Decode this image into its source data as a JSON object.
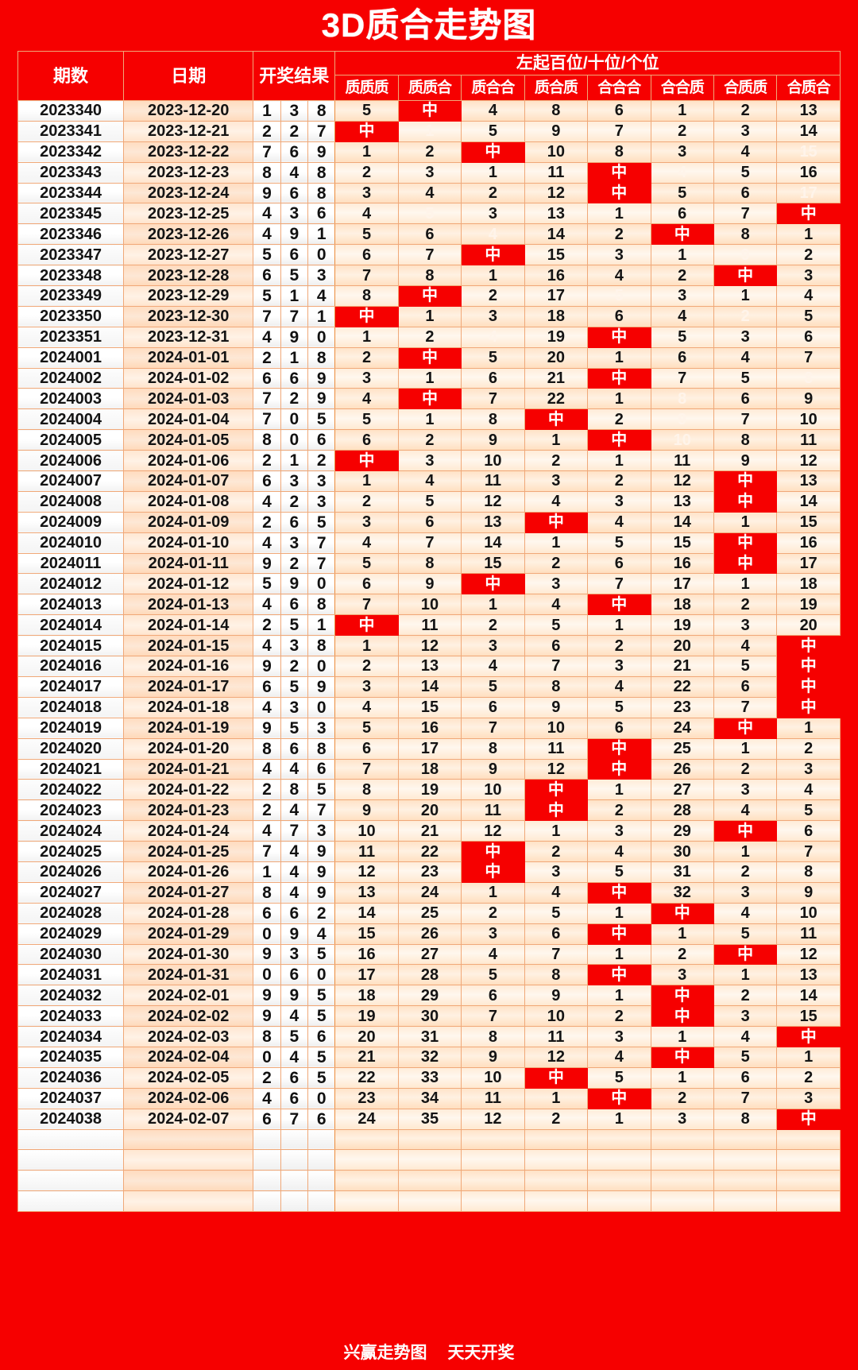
{
  "title": "3D质合走势图",
  "footer": {
    "left": "兴赢走势图",
    "right": "天天开奖"
  },
  "headers": {
    "issue": "期数",
    "date": "日期",
    "result": "开奖结果",
    "group": "左起百位/十位/个位",
    "positions": [
      "质质质",
      "质质合",
      "质合合",
      "质合质",
      "合合合",
      "合合质",
      "合质质",
      "合质合"
    ]
  },
  "hit_mark": "中",
  "colors": {
    "brand_red": "#f60000",
    "cell_peach": "#ffe3c8",
    "grid_line": "#f0a878",
    "faded_text": "#fff4ea",
    "text": "#141414"
  },
  "chart_data": {
    "type": "table",
    "title": "3D质合走势图",
    "columns": [
      "期数",
      "日期",
      "开奖结果",
      "质质质",
      "质质合",
      "质合合",
      "质合质",
      "合合合",
      "合合质",
      "合质质",
      "合质合"
    ],
    "empty_rows": 4,
    "rows": [
      {
        "issue": "2023340",
        "date": "2023-12-20",
        "balls": [
          1,
          3,
          8
        ],
        "cells": [
          "5",
          "中",
          "4",
          "8",
          "6",
          "1",
          "2",
          "13"
        ],
        "faded": []
      },
      {
        "issue": "2023341",
        "date": "2023-12-21",
        "balls": [
          2,
          2,
          7
        ],
        "cells": [
          "中",
          "1",
          "5",
          "9",
          "7",
          "2",
          "3",
          "14"
        ],
        "faded": [
          1
        ]
      },
      {
        "issue": "2023342",
        "date": "2023-12-22",
        "balls": [
          7,
          6,
          9
        ],
        "cells": [
          "1",
          "2",
          "中",
          "10",
          "8",
          "3",
          "4",
          "15"
        ],
        "faded": [
          7
        ]
      },
      {
        "issue": "2023343",
        "date": "2023-12-23",
        "balls": [
          8,
          4,
          8
        ],
        "cells": [
          "2",
          "3",
          "1",
          "11",
          "中",
          "4",
          "5",
          "16"
        ],
        "faded": [
          5
        ]
      },
      {
        "issue": "2023344",
        "date": "2023-12-24",
        "balls": [
          9,
          6,
          8
        ],
        "cells": [
          "3",
          "4",
          "2",
          "12",
          "中",
          "5",
          "6",
          "17"
        ],
        "faded": [
          7
        ]
      },
      {
        "issue": "2023345",
        "date": "2023-12-25",
        "balls": [
          4,
          3,
          6
        ],
        "cells": [
          "4",
          "5",
          "3",
          "13",
          "1",
          "6",
          "7",
          "中"
        ],
        "faded": [
          1
        ]
      },
      {
        "issue": "2023346",
        "date": "2023-12-26",
        "balls": [
          4,
          9,
          1
        ],
        "cells": [
          "5",
          "6",
          "4",
          "14",
          "2",
          "中",
          "8",
          "1"
        ],
        "faded": [
          2
        ]
      },
      {
        "issue": "2023347",
        "date": "2023-12-27",
        "balls": [
          5,
          6,
          0
        ],
        "cells": [
          "6",
          "7",
          "中",
          "15",
          "3",
          "1",
          "9",
          "2"
        ],
        "faded": [
          6
        ]
      },
      {
        "issue": "2023348",
        "date": "2023-12-28",
        "balls": [
          6,
          5,
          3
        ],
        "cells": [
          "7",
          "8",
          "1",
          "16",
          "4",
          "2",
          "中",
          "3"
        ],
        "faded": []
      },
      {
        "issue": "2023349",
        "date": "2023-12-29",
        "balls": [
          5,
          1,
          4
        ],
        "cells": [
          "8",
          "中",
          "2",
          "17",
          "5",
          "3",
          "1",
          "4"
        ],
        "faded": [
          4
        ]
      },
      {
        "issue": "2023350",
        "date": "2023-12-30",
        "balls": [
          7,
          7,
          1
        ],
        "cells": [
          "中",
          "1",
          "3",
          "18",
          "6",
          "4",
          "2",
          "5"
        ],
        "faded": [
          6
        ]
      },
      {
        "issue": "2023351",
        "date": "2023-12-31",
        "balls": [
          4,
          9,
          0
        ],
        "cells": [
          "1",
          "2",
          "4",
          "19",
          "中",
          "5",
          "3",
          "6"
        ],
        "faded": [
          2
        ]
      },
      {
        "issue": "2024001",
        "date": "2024-01-01",
        "balls": [
          2,
          1,
          8
        ],
        "cells": [
          "2",
          "中",
          "5",
          "20",
          "1",
          "6",
          "4",
          "7"
        ],
        "faded": []
      },
      {
        "issue": "2024002",
        "date": "2024-01-02",
        "balls": [
          6,
          6,
          9
        ],
        "cells": [
          "3",
          "1",
          "6",
          "21",
          "中",
          "7",
          "5",
          "8"
        ],
        "faded": [
          7
        ]
      },
      {
        "issue": "2024003",
        "date": "2024-01-03",
        "balls": [
          7,
          2,
          9
        ],
        "cells": [
          "4",
          "中",
          "7",
          "22",
          "1",
          "8",
          "6",
          "9"
        ],
        "faded": [
          5
        ]
      },
      {
        "issue": "2024004",
        "date": "2024-01-04",
        "balls": [
          7,
          0,
          5
        ],
        "cells": [
          "5",
          "1",
          "8",
          "中",
          "2",
          "9",
          "7",
          "10"
        ],
        "faded": [
          5
        ]
      },
      {
        "issue": "2024005",
        "date": "2024-01-05",
        "balls": [
          8,
          0,
          6
        ],
        "cells": [
          "6",
          "2",
          "9",
          "1",
          "中",
          "10",
          "8",
          "11"
        ],
        "faded": [
          5
        ]
      },
      {
        "issue": "2024006",
        "date": "2024-01-06",
        "balls": [
          2,
          1,
          2
        ],
        "cells": [
          "中",
          "3",
          "10",
          "2",
          "1",
          "11",
          "9",
          "12"
        ],
        "faded": []
      },
      {
        "issue": "2024007",
        "date": "2024-01-07",
        "balls": [
          6,
          3,
          3
        ],
        "cells": [
          "1",
          "4",
          "11",
          "3",
          "2",
          "12",
          "中",
          "13"
        ],
        "faded": []
      },
      {
        "issue": "2024008",
        "date": "2024-01-08",
        "balls": [
          4,
          2,
          3
        ],
        "cells": [
          "2",
          "5",
          "12",
          "4",
          "3",
          "13",
          "中",
          "14"
        ],
        "faded": []
      },
      {
        "issue": "2024009",
        "date": "2024-01-09",
        "balls": [
          2,
          6,
          5
        ],
        "cells": [
          "3",
          "6",
          "13",
          "中",
          "4",
          "14",
          "1",
          "15"
        ],
        "faded": []
      },
      {
        "issue": "2024010",
        "date": "2024-01-10",
        "balls": [
          4,
          3,
          7
        ],
        "cells": [
          "4",
          "7",
          "14",
          "1",
          "5",
          "15",
          "中",
          "16"
        ],
        "faded": []
      },
      {
        "issue": "2024011",
        "date": "2024-01-11",
        "balls": [
          9,
          2,
          7
        ],
        "cells": [
          "5",
          "8",
          "15",
          "2",
          "6",
          "16",
          "中",
          "17"
        ],
        "faded": []
      },
      {
        "issue": "2024012",
        "date": "2024-01-12",
        "balls": [
          5,
          9,
          0
        ],
        "cells": [
          "6",
          "9",
          "中",
          "3",
          "7",
          "17",
          "1",
          "18"
        ],
        "faded": []
      },
      {
        "issue": "2024013",
        "date": "2024-01-13",
        "balls": [
          4,
          6,
          8
        ],
        "cells": [
          "7",
          "10",
          "1",
          "4",
          "中",
          "18",
          "2",
          "19"
        ],
        "faded": []
      },
      {
        "issue": "2024014",
        "date": "2024-01-14",
        "balls": [
          2,
          5,
          1
        ],
        "cells": [
          "中",
          "11",
          "2",
          "5",
          "1",
          "19",
          "3",
          "20"
        ],
        "faded": []
      },
      {
        "issue": "2024015",
        "date": "2024-01-15",
        "balls": [
          4,
          3,
          8
        ],
        "cells": [
          "1",
          "12",
          "3",
          "6",
          "2",
          "20",
          "4",
          "中"
        ],
        "faded": []
      },
      {
        "issue": "2024016",
        "date": "2024-01-16",
        "balls": [
          9,
          2,
          0
        ],
        "cells": [
          "2",
          "13",
          "4",
          "7",
          "3",
          "21",
          "5",
          "中"
        ],
        "faded": []
      },
      {
        "issue": "2024017",
        "date": "2024-01-17",
        "balls": [
          6,
          5,
          9
        ],
        "cells": [
          "3",
          "14",
          "5",
          "8",
          "4",
          "22",
          "6",
          "中"
        ],
        "faded": []
      },
      {
        "issue": "2024018",
        "date": "2024-01-18",
        "balls": [
          4,
          3,
          0
        ],
        "cells": [
          "4",
          "15",
          "6",
          "9",
          "5",
          "23",
          "7",
          "中"
        ],
        "faded": []
      },
      {
        "issue": "2024019",
        "date": "2024-01-19",
        "balls": [
          9,
          5,
          3
        ],
        "cells": [
          "5",
          "16",
          "7",
          "10",
          "6",
          "24",
          "中",
          "1"
        ],
        "faded": []
      },
      {
        "issue": "2024020",
        "date": "2024-01-20",
        "balls": [
          8,
          6,
          8
        ],
        "cells": [
          "6",
          "17",
          "8",
          "11",
          "中",
          "25",
          "1",
          "2"
        ],
        "faded": []
      },
      {
        "issue": "2024021",
        "date": "2024-01-21",
        "balls": [
          4,
          4,
          6
        ],
        "cells": [
          "7",
          "18",
          "9",
          "12",
          "中",
          "26",
          "2",
          "3"
        ],
        "faded": []
      },
      {
        "issue": "2024022",
        "date": "2024-01-22",
        "balls": [
          2,
          8,
          5
        ],
        "cells": [
          "8",
          "19",
          "10",
          "中",
          "1",
          "27",
          "3",
          "4"
        ],
        "faded": []
      },
      {
        "issue": "2024023",
        "date": "2024-01-23",
        "balls": [
          2,
          4,
          7
        ],
        "cells": [
          "9",
          "20",
          "11",
          "中",
          "2",
          "28",
          "4",
          "5"
        ],
        "faded": []
      },
      {
        "issue": "2024024",
        "date": "2024-01-24",
        "balls": [
          4,
          7,
          3
        ],
        "cells": [
          "10",
          "21",
          "12",
          "1",
          "3",
          "29",
          "中",
          "6"
        ],
        "faded": []
      },
      {
        "issue": "2024025",
        "date": "2024-01-25",
        "balls": [
          7,
          4,
          9
        ],
        "cells": [
          "11",
          "22",
          "中",
          "2",
          "4",
          "30",
          "1",
          "7"
        ],
        "faded": []
      },
      {
        "issue": "2024026",
        "date": "2024-01-26",
        "balls": [
          1,
          4,
          9
        ],
        "cells": [
          "12",
          "23",
          "中",
          "3",
          "5",
          "31",
          "2",
          "8"
        ],
        "faded": []
      },
      {
        "issue": "2024027",
        "date": "2024-01-27",
        "balls": [
          8,
          4,
          9
        ],
        "cells": [
          "13",
          "24",
          "1",
          "4",
          "中",
          "32",
          "3",
          "9"
        ],
        "faded": []
      },
      {
        "issue": "2024028",
        "date": "2024-01-28",
        "balls": [
          6,
          6,
          2
        ],
        "cells": [
          "14",
          "25",
          "2",
          "5",
          "1",
          "中",
          "4",
          "10"
        ],
        "faded": []
      },
      {
        "issue": "2024029",
        "date": "2024-01-29",
        "balls": [
          0,
          9,
          4
        ],
        "cells": [
          "15",
          "26",
          "3",
          "6",
          "中",
          "1",
          "5",
          "11"
        ],
        "faded": []
      },
      {
        "issue": "2024030",
        "date": "2024-01-30",
        "balls": [
          9,
          3,
          5
        ],
        "cells": [
          "16",
          "27",
          "4",
          "7",
          "1",
          "2",
          "中",
          "12"
        ],
        "faded": []
      },
      {
        "issue": "2024031",
        "date": "2024-01-31",
        "balls": [
          0,
          6,
          0
        ],
        "cells": [
          "17",
          "28",
          "5",
          "8",
          "中",
          "3",
          "1",
          "13"
        ],
        "faded": []
      },
      {
        "issue": "2024032",
        "date": "2024-02-01",
        "balls": [
          9,
          9,
          5
        ],
        "cells": [
          "18",
          "29",
          "6",
          "9",
          "1",
          "中",
          "2",
          "14"
        ],
        "faded": []
      },
      {
        "issue": "2024033",
        "date": "2024-02-02",
        "balls": [
          9,
          4,
          5
        ],
        "cells": [
          "19",
          "30",
          "7",
          "10",
          "2",
          "中",
          "3",
          "15"
        ],
        "faded": []
      },
      {
        "issue": "2024034",
        "date": "2024-02-03",
        "balls": [
          8,
          5,
          6
        ],
        "cells": [
          "20",
          "31",
          "8",
          "11",
          "3",
          "1",
          "4",
          "中"
        ],
        "faded": []
      },
      {
        "issue": "2024035",
        "date": "2024-02-04",
        "balls": [
          0,
          4,
          5
        ],
        "cells": [
          "21",
          "32",
          "9",
          "12",
          "4",
          "中",
          "5",
          "1"
        ],
        "faded": []
      },
      {
        "issue": "2024036",
        "date": "2024-02-05",
        "balls": [
          2,
          6,
          5
        ],
        "cells": [
          "22",
          "33",
          "10",
          "中",
          "5",
          "1",
          "6",
          "2"
        ],
        "faded": []
      },
      {
        "issue": "2024037",
        "date": "2024-02-06",
        "balls": [
          4,
          6,
          0
        ],
        "cells": [
          "23",
          "34",
          "11",
          "1",
          "中",
          "2",
          "7",
          "3"
        ],
        "faded": []
      },
      {
        "issue": "2024038",
        "date": "2024-02-07",
        "balls": [
          6,
          7,
          6
        ],
        "cells": [
          "24",
          "35",
          "12",
          "2",
          "1",
          "3",
          "8",
          "中"
        ],
        "faded": []
      }
    ]
  }
}
